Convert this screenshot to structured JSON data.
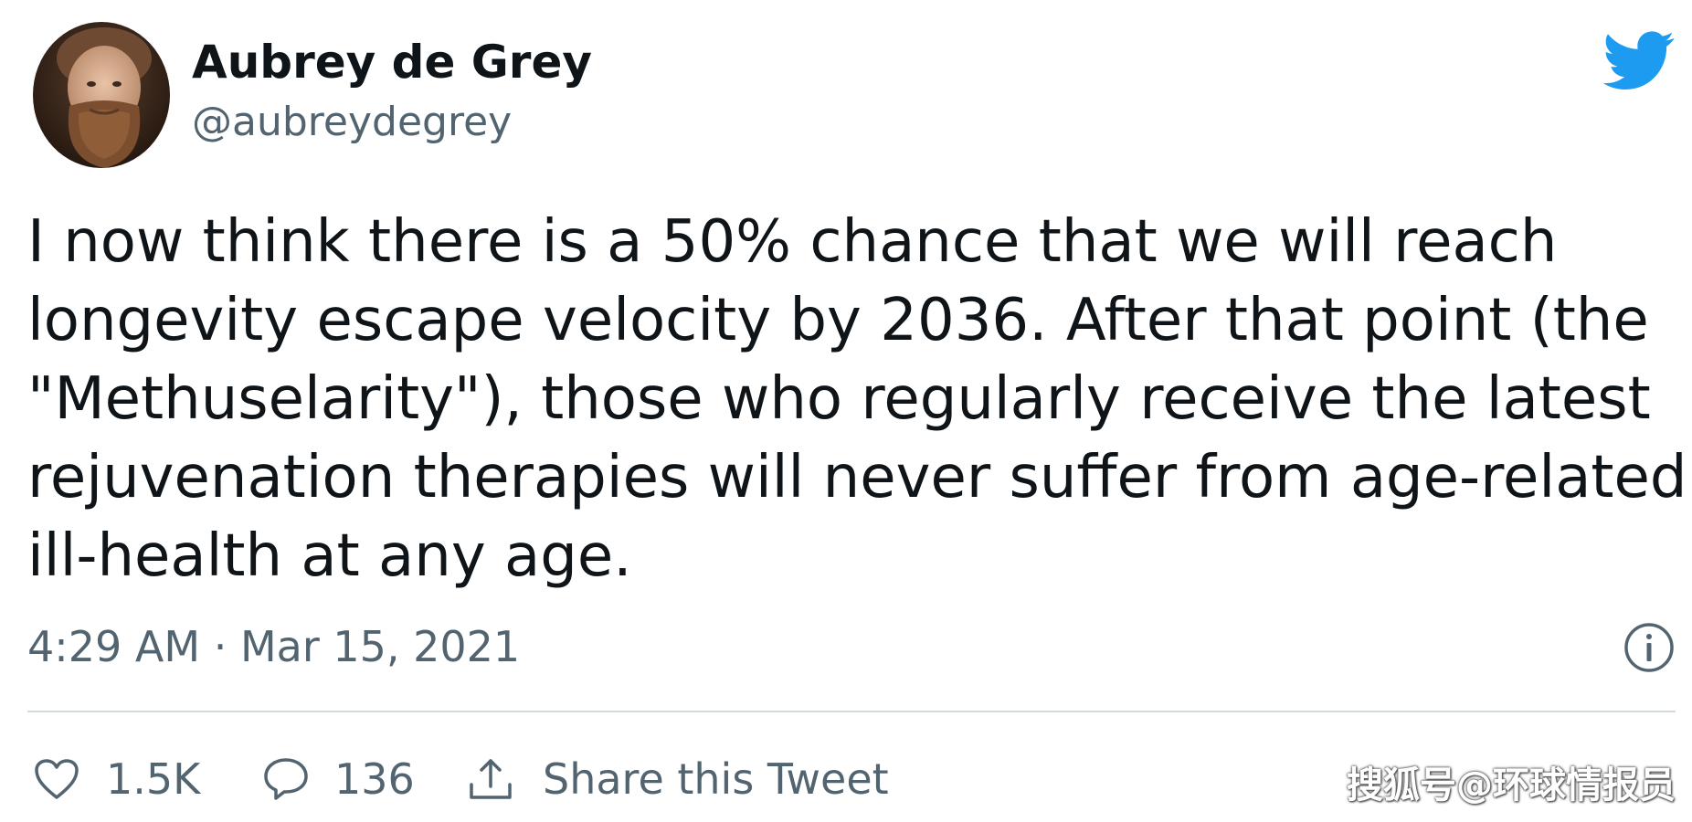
{
  "author": {
    "name": "Aubrey de Grey",
    "handle": "@aubreydegrey"
  },
  "tweet": {
    "text_lines": [
      "I now think there is a 50% chance that we will reach",
      "longevity escape velocity by 2036. After that point (the",
      "\"Methuselarity\"), those who regularly receive the latest",
      "rejuvenation therapies will never suffer from age-related",
      "ill-health at any age."
    ],
    "timestamp": "4:29 AM · Mar 15, 2021"
  },
  "actions": {
    "likes": "1.5K",
    "replies": "136",
    "share_label": "Share this Tweet"
  },
  "icons": {
    "brand": "twitter-bird-icon",
    "info": "info-icon",
    "like": "heart-icon",
    "reply": "reply-icon",
    "share": "share-icon"
  },
  "colors": {
    "text_primary": "#0f1419",
    "text_secondary": "#536471",
    "twitter_blue": "#1d9bf0",
    "divider": "#cfd9de"
  },
  "watermark": "搜狐号@环球情报员"
}
